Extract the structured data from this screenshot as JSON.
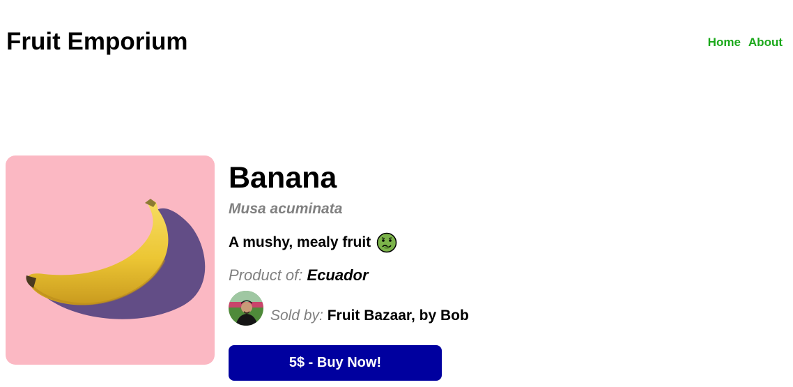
{
  "header": {
    "title": "Fruit Emporium",
    "nav": [
      {
        "label": "Home"
      },
      {
        "label": "About"
      }
    ],
    "nav_color": "#1aa81a"
  },
  "product": {
    "image_icon": "banana-photo",
    "image_background": "#fbb8c3",
    "name": "Banana",
    "scientific_name": "Musa acuminata",
    "description": "A mushy, mealy fruit",
    "description_icon": "nauseated-face-icon",
    "origin_label": "Product of:",
    "origin": "Ecuador",
    "seller_label": "Sold by:",
    "seller": "Fruit Bazaar, by Bob",
    "seller_avatar_icon": "seller-avatar",
    "buy_label": "5$ - Buy Now!",
    "button_color": "#00009f"
  }
}
